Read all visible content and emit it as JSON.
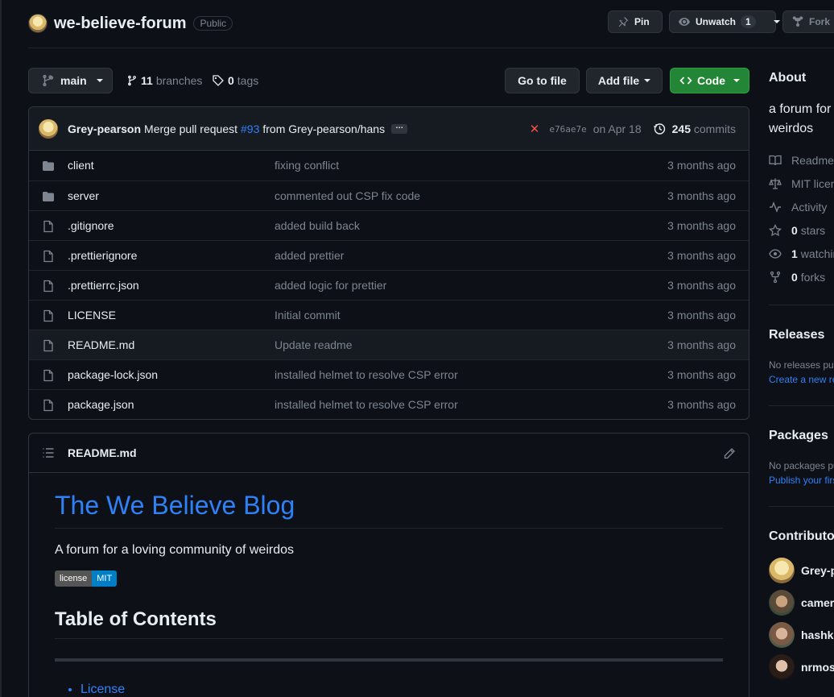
{
  "repo": {
    "name": "we-believe-forum",
    "visibility": "Public"
  },
  "header_actions": {
    "pin": "Pin",
    "unwatch": "Unwatch",
    "watch_count": "1",
    "fork": "Fork"
  },
  "toolbar": {
    "branch": "main",
    "branches_count": "11",
    "branches_label": "branches",
    "tags_count": "0",
    "tags_label": "tags",
    "go_to_file": "Go to file",
    "add_file": "Add file",
    "code": "Code"
  },
  "latest_commit": {
    "author": "Grey-pearson",
    "message_prefix": "Merge pull request",
    "pr_link": "#93",
    "message_suffix": "from Grey-pearson/hans",
    "ellipsis": "…",
    "sha": "e76ae7e",
    "date": "on Apr 18",
    "commits_count": "245",
    "commits_label": "commits"
  },
  "files": [
    {
      "name": "client",
      "type": "folder",
      "commit": "fixing conflict",
      "age": "3 months ago"
    },
    {
      "name": "server",
      "type": "folder",
      "commit": "commented out CSP fix code",
      "age": "3 months ago"
    },
    {
      "name": ".gitignore",
      "type": "file",
      "commit": "added build back",
      "age": "3 months ago"
    },
    {
      "name": ".prettierignore",
      "type": "file",
      "commit": "added prettier",
      "age": "3 months ago"
    },
    {
      "name": ".prettierrc.json",
      "type": "file",
      "commit": "added logic for prettier",
      "age": "3 months ago"
    },
    {
      "name": "LICENSE",
      "type": "file",
      "commit": "Initial commit",
      "age": "3 months ago"
    },
    {
      "name": "README.md",
      "type": "file",
      "commit": "Update readme",
      "age": "3 months ago"
    },
    {
      "name": "package-lock.json",
      "type": "file",
      "commit": "installed helmet to resolve CSP error",
      "age": "3 months ago"
    },
    {
      "name": "package.json",
      "type": "file",
      "commit": "installed helmet to resolve CSP error",
      "age": "3 months ago"
    }
  ],
  "readme": {
    "filename": "README.md",
    "h1": "The We Believe Blog",
    "description": "A forum for a loving community of weirdos",
    "badge_left": "license",
    "badge_right": "MIT",
    "toc_heading": "Table of Contents",
    "toc_items": [
      "License"
    ]
  },
  "sidebar": {
    "about_heading": "About",
    "about_desc": "a forum for weirdos",
    "readme": "Readme",
    "license": "MIT license",
    "activity": "Activity",
    "stars_count": "0",
    "stars_label": "stars",
    "watching_count": "1",
    "watching_label": "watching",
    "forks_count": "0",
    "forks_label": "forks",
    "releases_heading": "Releases",
    "releases_none": "No releases published",
    "releases_link": "Create a new release",
    "packages_heading": "Packages",
    "packages_none": "No packages published",
    "packages_link": "Publish your first package",
    "contributors_heading": "Contributors",
    "contributors": [
      "Grey-pearson",
      "cameran",
      "hashken",
      "nrmosc"
    ]
  },
  "colors": {
    "background": "#0d1117",
    "link": "#2f81f7",
    "green_button": "#238636",
    "error_x": "#f85149"
  }
}
